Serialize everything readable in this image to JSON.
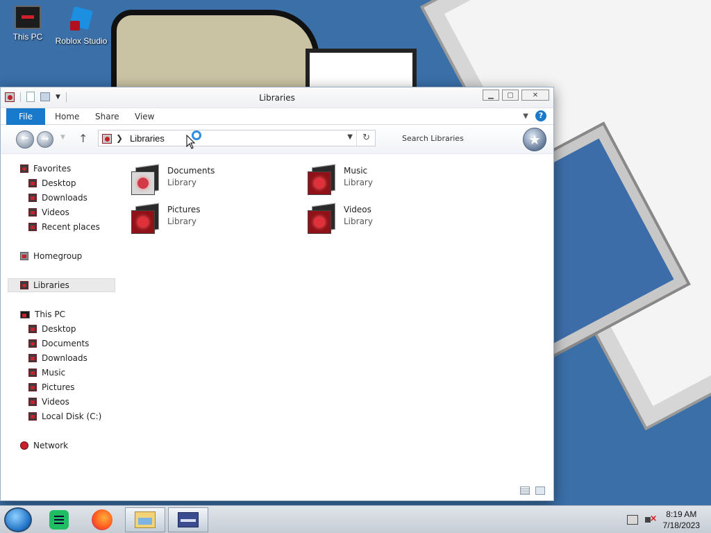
{
  "desktop": {
    "icons": [
      {
        "label": "This PC"
      },
      {
        "label": "Roblox Studio"
      }
    ]
  },
  "window": {
    "title": "Libraries",
    "ribbon_tabs": [
      "File",
      "Home",
      "Share",
      "View"
    ],
    "address": {
      "path": "Libraries"
    },
    "search_placeholder": "Search Libraries",
    "nav_tree": {
      "favorites": {
        "label": "Favorites",
        "items": [
          "Desktop",
          "Downloads",
          "Videos",
          "Recent places"
        ]
      },
      "homegroup": "Homegroup",
      "libraries": "Libraries",
      "this_pc": {
        "label": "This PC",
        "items": [
          "Desktop",
          "Documents",
          "Downloads",
          "Music",
          "Pictures",
          "Videos",
          "Local Disk (C:)"
        ]
      },
      "network": "Network"
    },
    "libraries": [
      {
        "name": "Documents",
        "type": "Library"
      },
      {
        "name": "Music",
        "type": "Library"
      },
      {
        "name": "Pictures",
        "type": "Library"
      },
      {
        "name": "Videos",
        "type": "Library"
      }
    ]
  },
  "taskbar": {
    "apps": [
      "start",
      "notes",
      "firefox",
      "file-explorer",
      "window-app"
    ],
    "clock": {
      "time": "8:19 AM",
      "date": "7/18/2023"
    }
  },
  "colors": {
    "accent": "#1979ca",
    "desktop_bg": "#3a6fa8"
  }
}
